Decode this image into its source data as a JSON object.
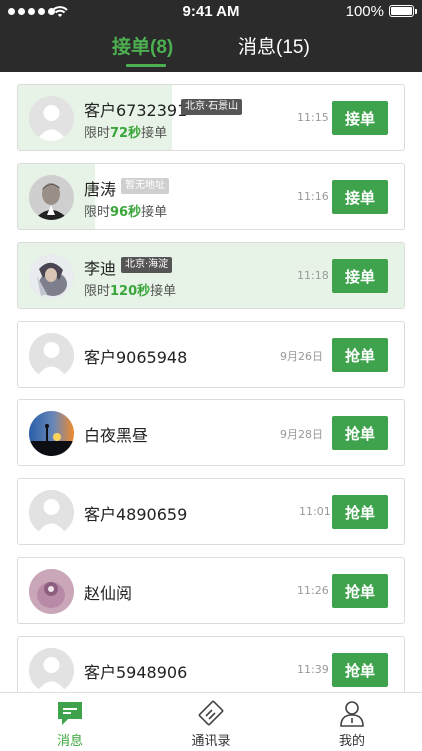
{
  "status_bar": {
    "time": "9:41 AM",
    "battery": "100%"
  },
  "tabs": {
    "orders": "接单(8)",
    "messages": "消息(15)"
  },
  "items": [
    {
      "name": "客户6732391",
      "tag": "北京·石景山",
      "prefix": "限时",
      "seconds": "72秒",
      "suffix": "接单",
      "time": "11:15",
      "button": "接单"
    },
    {
      "name": "唐涛",
      "tag": "暂无地址",
      "prefix": "限时",
      "seconds": "96秒",
      "suffix": "接单",
      "time": "11:16",
      "button": "接单"
    },
    {
      "name": "李迪",
      "tag": "北京·海淀",
      "prefix": "限时",
      "seconds": "120秒",
      "suffix": "接单",
      "time": "11:18",
      "button": "接单"
    },
    {
      "name": "客户9065948",
      "time": "9月26日",
      "button": "抢单"
    },
    {
      "name": "白夜黑昼",
      "time": "9月28日",
      "button": "抢单"
    },
    {
      "name": "客户4890659",
      "time": "11:01",
      "button": "抢单"
    },
    {
      "name": "赵仙阅",
      "time": "11:26",
      "button": "抢单"
    },
    {
      "name": "客户5948906",
      "time": "11:39",
      "button": "抢单"
    }
  ],
  "bottom_nav": [
    {
      "label": "消息",
      "icon": "message-icon",
      "active": true
    },
    {
      "label": "通讯录",
      "icon": "contacts-icon"
    },
    {
      "label": "我的",
      "icon": "profile-icon"
    }
  ],
  "colors": {
    "accent": "#3fa34d",
    "header": "#2b2b2b",
    "countdown_bg": "#e6f3e6"
  },
  "countdown_progress": [
    0.4,
    0.2,
    1.0
  ]
}
